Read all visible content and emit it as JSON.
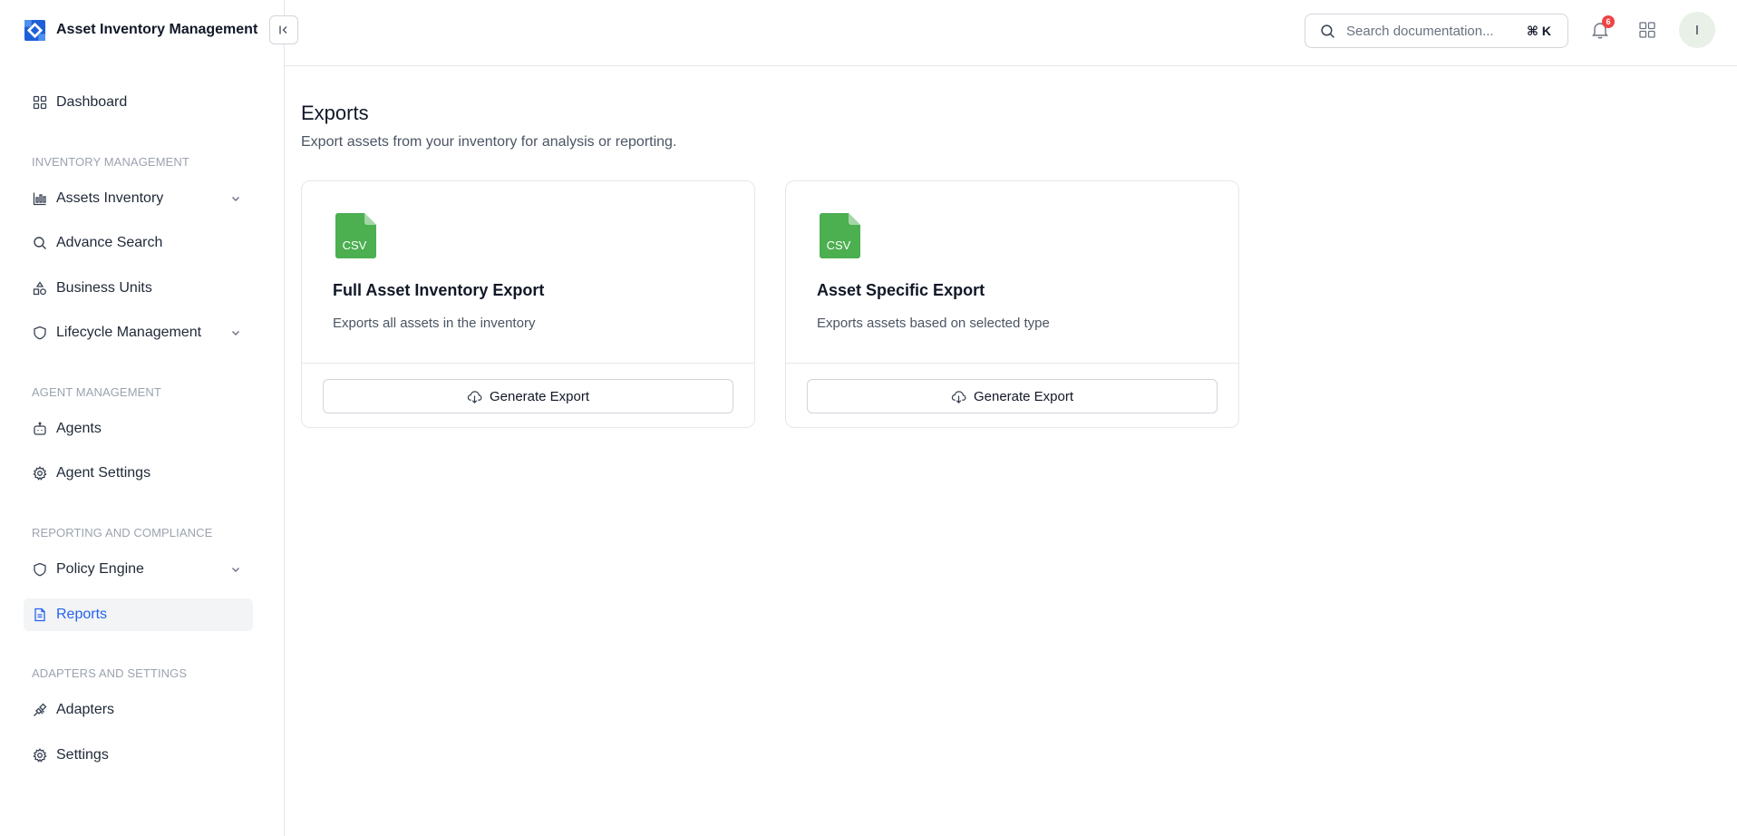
{
  "brand": {
    "name": "Asset Inventory Management",
    "color": "#2563eb"
  },
  "sidebar": {
    "dashboard": {
      "label": "Dashboard",
      "icon": "grid-icon"
    },
    "sections": [
      {
        "label": "INVENTORY MANAGEMENT"
      },
      {
        "label": "AGENT MANAGEMENT"
      },
      {
        "label": "REPORTING AND COMPLIANCE"
      },
      {
        "label": "ADAPTERS AND SETTINGS"
      }
    ],
    "items": [
      {
        "label": "Assets Inventory",
        "icon": "bar-chart-icon",
        "expandable": true
      },
      {
        "label": "Advance Search",
        "icon": "search-icon"
      },
      {
        "label": "Business Units",
        "icon": "shapes-icon"
      },
      {
        "label": "Lifecycle Management",
        "icon": "shield-icon",
        "expandable": true
      },
      {
        "label": "Agents",
        "icon": "bot-icon"
      },
      {
        "label": "Agent Settings",
        "icon": "gear-icon"
      },
      {
        "label": "Policy Engine",
        "icon": "shield-icon",
        "expandable": true
      },
      {
        "label": "Reports",
        "icon": "document-icon",
        "active": true
      },
      {
        "label": "Adapters",
        "icon": "plug-icon"
      },
      {
        "label": "Settings",
        "icon": "gear-icon"
      }
    ]
  },
  "header": {
    "search_placeholder": "Search documentation...",
    "shortcut": "⌘ K",
    "notifications_count": "6",
    "avatar_initial": "I"
  },
  "main": {
    "title": "Exports",
    "subtitle": "Export assets from your inventory for analysis or reporting.",
    "cards": [
      {
        "file_label": "CSV",
        "title": "Full Asset Inventory Export",
        "description": "Exports all assets in the inventory",
        "button_label": "Generate Export"
      },
      {
        "file_label": "CSV",
        "title": "Asset Specific Export",
        "description": "Exports assets based on selected type",
        "button_label": "Generate Export"
      }
    ]
  },
  "colors": {
    "accent": "#2563eb",
    "csv_green": "#4caf50",
    "badge": "#ef4444",
    "active_bg": "#f3f4f6"
  }
}
